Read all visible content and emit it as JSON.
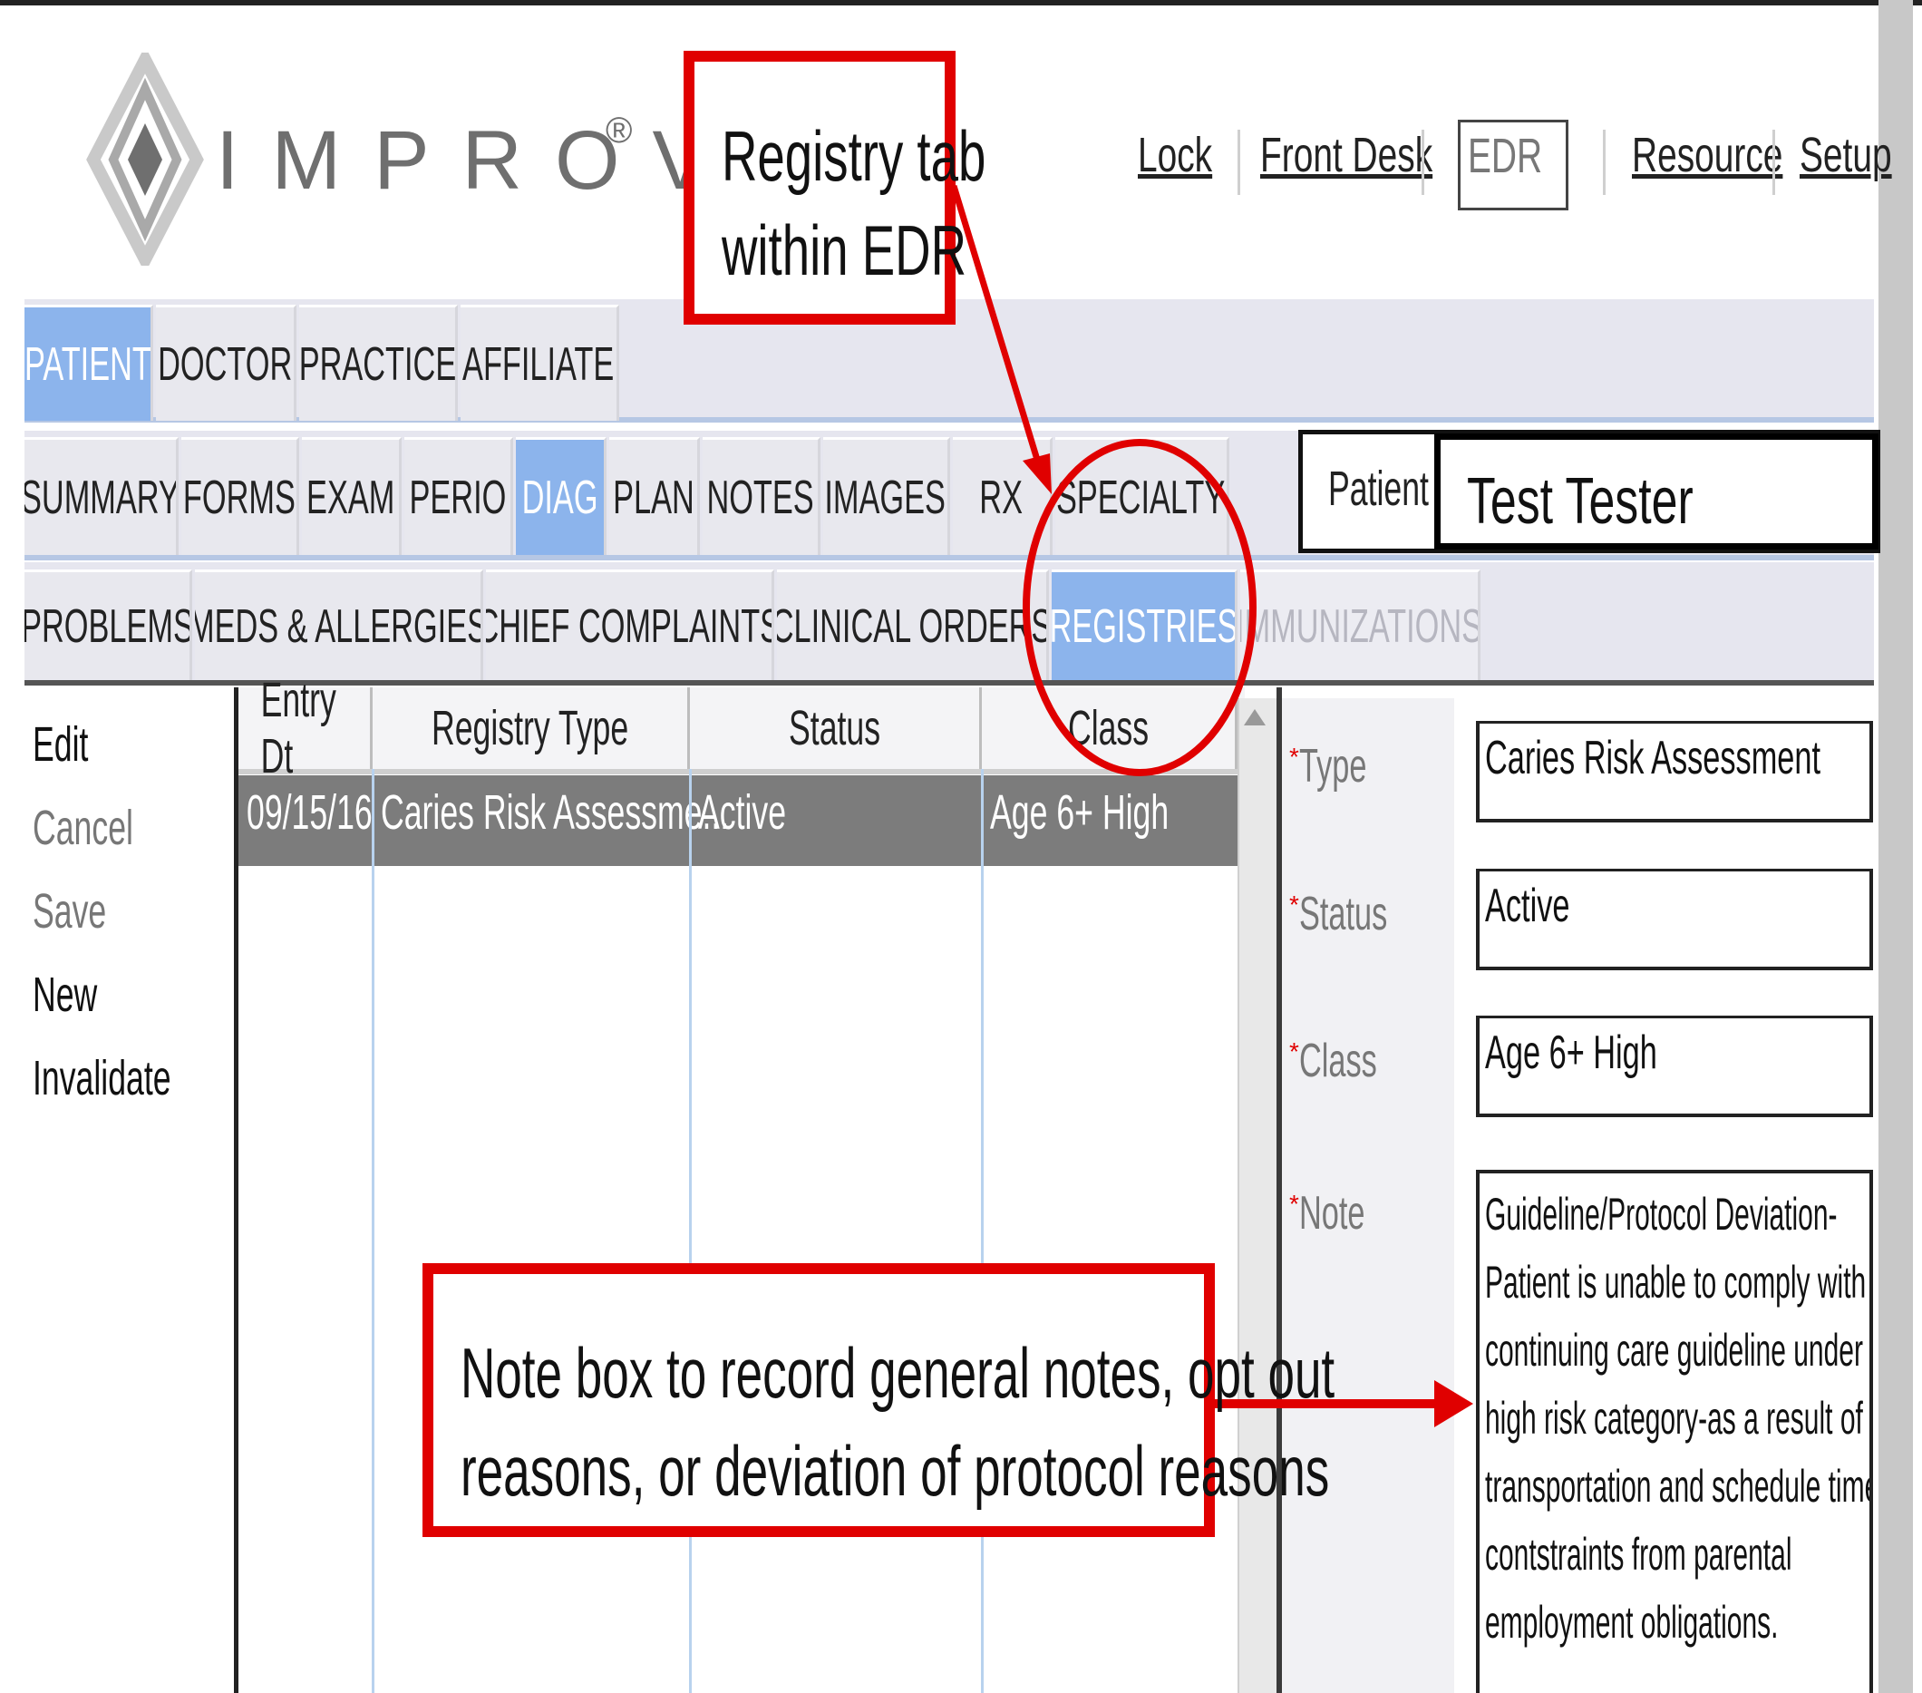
{
  "brand": {
    "name": "IMPROVIS",
    "reg_mark": "®"
  },
  "top_nav": {
    "lock": "Lock",
    "front_desk": "Front Desk",
    "edr": "EDR",
    "resource": "Resource",
    "setup": "Setup"
  },
  "module_tabs": [
    "PATIENT",
    "DOCTOR",
    "PRACTICE",
    "AFFILIATE"
  ],
  "section_tabs": [
    "SUMMARY",
    "FORMS",
    "EXAM",
    "PERIO",
    "DIAG",
    "PLAN",
    "NOTES",
    "IMAGES",
    "RX",
    "SPECIALTY"
  ],
  "diag_tabs": [
    "PROBLEMS",
    "MEDS & ALLERGIES",
    "CHIEF COMPLAINTS",
    "CLINICAL ORDERS",
    "REGISTRIES",
    "IMMUNIZATIONS"
  ],
  "active": {
    "module": "PATIENT",
    "section": "DIAG",
    "diag": "REGISTRIES"
  },
  "patient": {
    "label": "Patient",
    "name": "Test Tester"
  },
  "actions": {
    "edit": "Edit",
    "cancel": "Cancel",
    "save": "Save",
    "new": "New",
    "invalidate": "Invalidate"
  },
  "grid": {
    "columns": [
      "Entry Dt",
      "Registry Type",
      "Status",
      "Class"
    ],
    "rows": [
      {
        "entry_dt": "09/15/16",
        "registry_type": "Caries Risk Assessme...",
        "status": "Active",
        "class": "Age 6+ High"
      }
    ]
  },
  "form": {
    "required_mark": "*",
    "type_label": "Type",
    "type_value": "Caries Risk Assessment",
    "status_label": "Status",
    "status_value": "Active",
    "class_label": "Class",
    "class_value": "Age 6+ High",
    "note_label": "Note",
    "note_lines": [
      "Guideline/Protocol Deviation-",
      "Patient is unable to comply with",
      "continuing care guideline under",
      "high risk category-as a result of",
      "transportation and schedule time",
      "contstraints from parental",
      "employment obligations."
    ]
  },
  "annotations": {
    "registry_callout": [
      "Registry tab",
      "within EDR"
    ],
    "note_callout": [
      "Note box to record general notes, opt out",
      "reasons, or deviation of protocol reasons"
    ]
  },
  "colors": {
    "annotation": "#e00000",
    "active_tab": "#8cb4ec",
    "selected_row": "#7c7c7c"
  }
}
